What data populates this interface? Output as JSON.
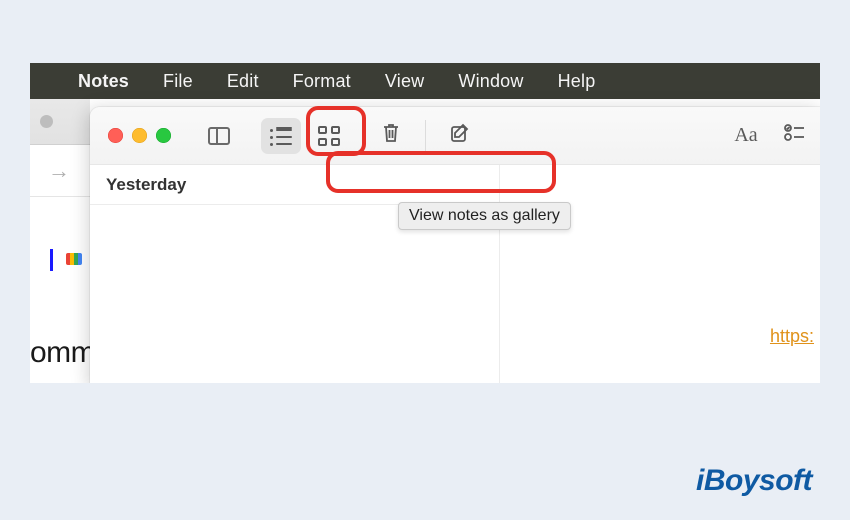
{
  "menubar": {
    "app": "Notes",
    "items": [
      "File",
      "Edit",
      "Format",
      "View",
      "Window",
      "Help"
    ]
  },
  "notes": {
    "toolbar": {
      "sidebar_tip": "Show Folders",
      "list_tip": "View as list",
      "gallery_tip": "View notes as gallery",
      "delete_tip": "Delete",
      "compose_tip": "New Note",
      "aa_label": "Aa"
    },
    "list": {
      "group_label": "Yesterday"
    },
    "content": {
      "link_text": "https:"
    }
  },
  "background": {
    "cut_text": "omm"
  },
  "tooltip_text": "View notes as gallery",
  "watermark": "iBoysoft"
}
